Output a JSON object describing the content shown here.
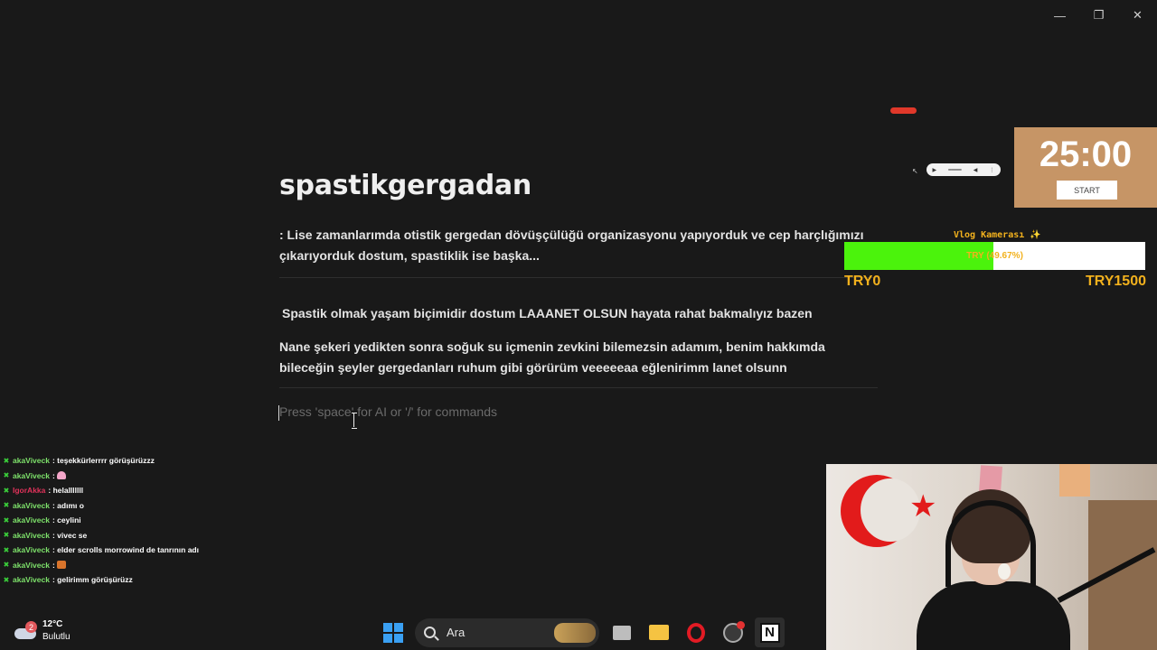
{
  "window": {
    "minimize": "—",
    "restore": "❐",
    "close": "✕"
  },
  "page": {
    "title": "spastikgergadan",
    "blocks": [
      ": Lise zamanlarımda otistik gergedan dövüşçülüğü organizasyonu yapıyorduk ve cep harçlığımızı çıkarıyorduk dostum, spastiklik ise başka...",
      "Spastik olmak yaşam biçimidir dostum LAAANET OLSUN hayata rahat bakmalıyız bazen",
      "Nane şekeri yedikten sonra soğuk su içmenin zevkini bilemezsin adamım, benim hakkımda bileceğin şeyler gergedanları ruhum gibi görürüm veeeeeaa eğlenirimm lanet olsunn"
    ],
    "placeholder": "Press 'space' for AI or '/' for commands"
  },
  "timer": {
    "value": "25:00",
    "button": "START"
  },
  "goal": {
    "label": "Vlog Kamerası ✨",
    "progress_text": "TRY (49.67%)",
    "percent": 49.67,
    "min": "TRY0",
    "max": "TRY1500",
    "fill_color": "#4bf30c",
    "text_color": "#f2b11d"
  },
  "chat": [
    {
      "user": "akaViveck",
      "color": "#7ee26b",
      "msg": ": teşekkürlerrrr görüşürüzzz"
    },
    {
      "user": "akaViveck",
      "color": "#7ee26b",
      "msg": ":",
      "emoji": "heart"
    },
    {
      "user": "IgorAkka",
      "color": "#e0325a",
      "msg": ": helalllllll"
    },
    {
      "user": "akaViveck",
      "color": "#7ee26b",
      "msg": ": adımı o"
    },
    {
      "user": "akaViveck",
      "color": "#7ee26b",
      "msg": ": ceylini"
    },
    {
      "user": "akaViveck",
      "color": "#7ee26b",
      "msg": ": vivec se"
    },
    {
      "user": "akaViveck",
      "color": "#7ee26b",
      "msg": ": elder scrolls morrowind de tanrının adı"
    },
    {
      "user": "akaViveck",
      "color": "#7ee26b",
      "msg": ":",
      "emoji": "food"
    },
    {
      "user": "akaViveck",
      "color": "#7ee26b",
      "msg": ": gelirimm görüşürüzz"
    }
  ],
  "taskbar": {
    "weather_badge": "2",
    "temperature": "12°C",
    "condition": "Bulutlu",
    "search_label": "Ara",
    "icons": [
      "windows-start-icon",
      "search-icon",
      "desktop-app-icon",
      "file-explorer-icon",
      "opera-browser-icon",
      "chrome-icon",
      "notion-icon"
    ]
  }
}
